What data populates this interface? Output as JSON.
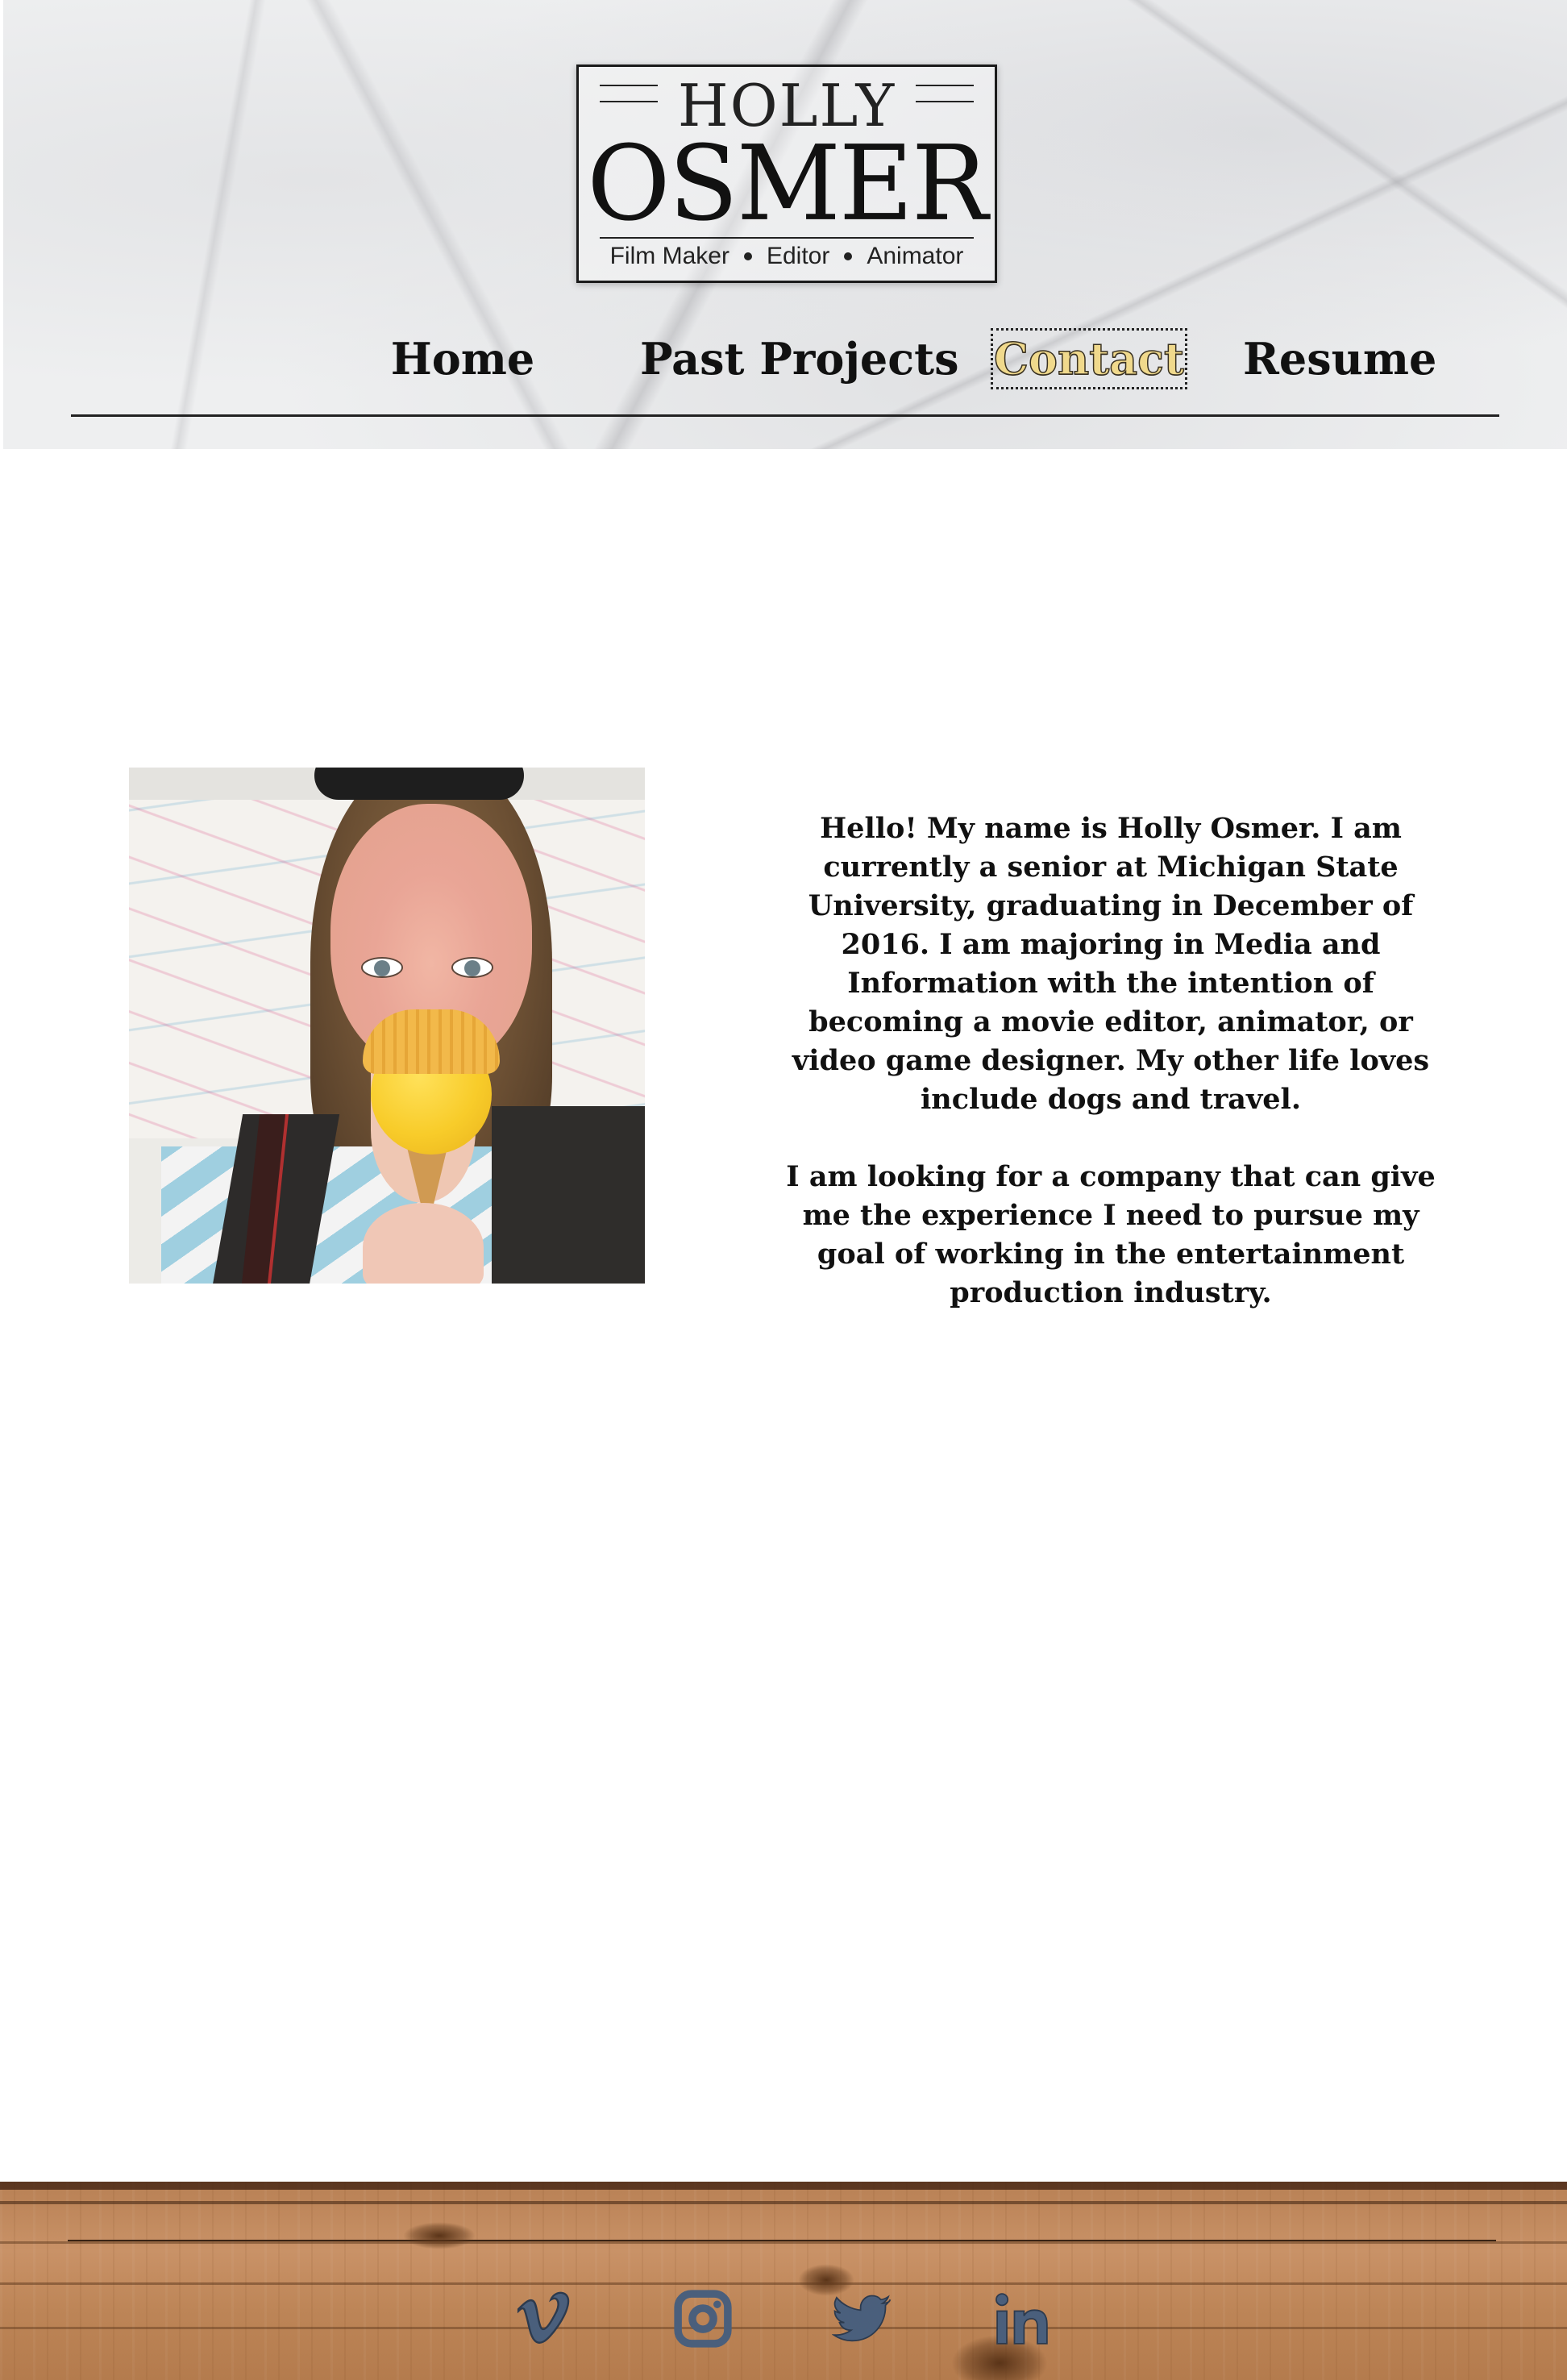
{
  "logo": {
    "first_name": "HOLLY",
    "last_name": "OSMER",
    "tagline": [
      "Film Maker",
      "Editor",
      "Animator"
    ]
  },
  "nav": {
    "items": [
      {
        "label": "Home"
      },
      {
        "label": "Past Projects"
      },
      {
        "label": "Contact",
        "active": true
      },
      {
        "label": "Resume"
      }
    ]
  },
  "bio": {
    "paragraph_1": "Hello! My name is Holly Osmer. I am currently a senior at Michigan State University, graduating in December of 2016. I am majoring in Media and Information with the intention of becoming a movie editor, animator, or video game designer. My other life loves include dogs and travel.",
    "paragraph_2": "I am looking for a company that can give me the experience I need to pursue my goal of working in the entertainment production industry."
  },
  "footer": {
    "social_icons": [
      "vimeo-icon",
      "instagram-icon",
      "twitter-icon",
      "linkedin-icon"
    ],
    "icon_color": "#4a5f7c"
  },
  "colors": {
    "active_nav_fill": "#f0d98c",
    "text": "#111111"
  }
}
